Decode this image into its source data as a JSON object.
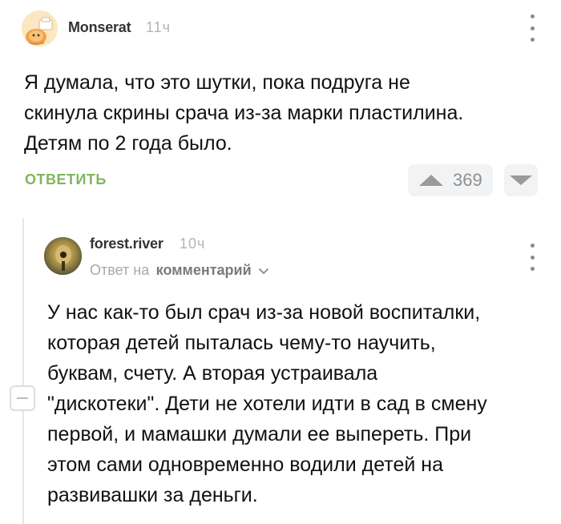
{
  "comments": [
    {
      "author": "Monserat",
      "time": "11ч",
      "text": "Я думала, что это шутки, пока подруга не\nскинула скрины срача из-за марки пластилина.\nДетям по 2 года было.",
      "reply_label": "ОТВЕТИТЬ",
      "rating": "369",
      "icons": {
        "avatar": "avatar-icon",
        "menu": "more-vertical-icon",
        "upvote": "triangle-up-icon",
        "downvote": "triangle-down-icon"
      }
    },
    {
      "author": "forest.river",
      "time": "10ч",
      "reply_prefix": "Ответ на",
      "reply_target": "комментарий",
      "text": "У нас как-то был срач из-за новой воспиталки,\nкоторая детей пыталась чему-то научить,\nбуквам, счету. А вторая устраивала\n\"дискотеки\". Дети не хотели идти в сад в смену\nпервой, и мамашки думали ее выпереть. При\nэтом сами одновременно водили детей на\nразвивашки за деньги.",
      "icons": {
        "avatar": "avatar-icon",
        "menu": "more-vertical-icon",
        "reply_target_toggle": "chevron-down-icon",
        "collapse": "minus-icon"
      }
    }
  ],
  "colors": {
    "reply_green": "#7fb65e",
    "muted": "#b4b4b4",
    "vote_bg": "#f2f3f5"
  }
}
